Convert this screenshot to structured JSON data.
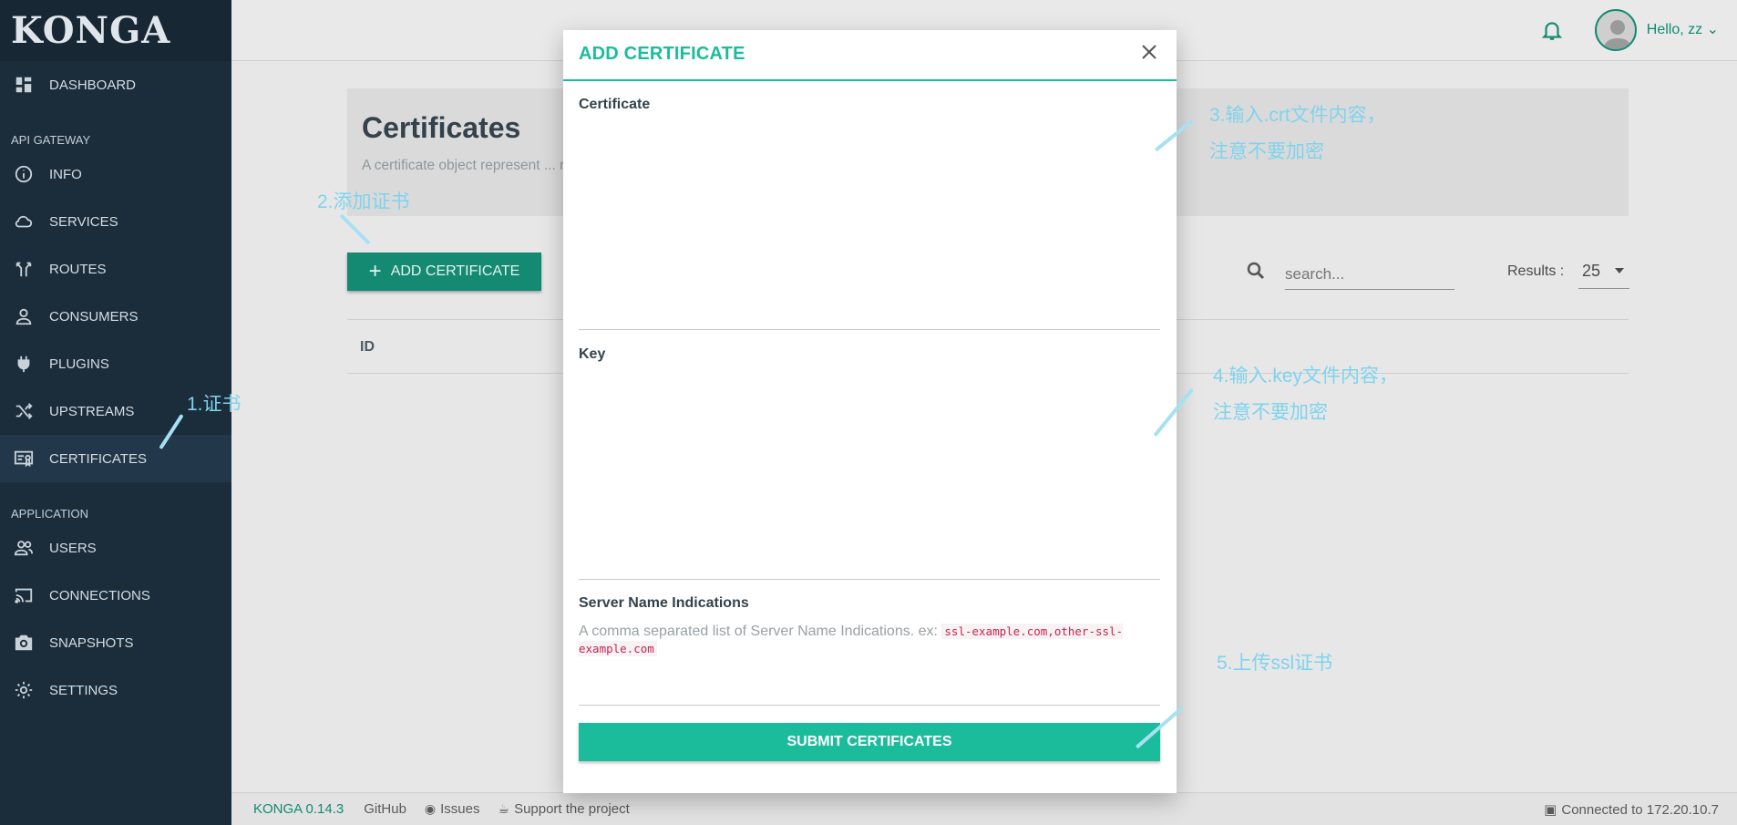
{
  "brand": "KONGA",
  "sidebar": {
    "items": [
      {
        "label": "DASHBOARD",
        "icon": "dashboard-icon"
      },
      {
        "section": "API GATEWAY"
      },
      {
        "label": "INFO",
        "icon": "info-icon"
      },
      {
        "label": "SERVICES",
        "icon": "cloud-icon"
      },
      {
        "label": "ROUTES",
        "icon": "routes-icon"
      },
      {
        "label": "CONSUMERS",
        "icon": "person-icon"
      },
      {
        "label": "PLUGINS",
        "icon": "plug-icon"
      },
      {
        "label": "UPSTREAMS",
        "icon": "shuffle-icon"
      },
      {
        "label": "CERTIFICATES",
        "icon": "certificate-icon",
        "active": true
      },
      {
        "section": "APPLICATION"
      },
      {
        "label": "USERS",
        "icon": "users-icon"
      },
      {
        "label": "CONNECTIONS",
        "icon": "cast-icon"
      },
      {
        "label": "SNAPSHOTS",
        "icon": "camera-icon"
      },
      {
        "label": "SETTINGS",
        "icon": "gear-icon"
      }
    ]
  },
  "topbar": {
    "greeting": "Hello, zz"
  },
  "page": {
    "title": "Certificates",
    "description": "A certificate object represent ... ng to handle SSL/TLS termination for encrypted requests. Certificates are optionally ass",
    "add_button": "ADD CERTIFICATE",
    "search_placeholder": "search...",
    "results_label": "Results :",
    "results_value": "25",
    "table_header_id": "ID"
  },
  "modal": {
    "title": "ADD CERTIFICATE",
    "certificate_label": "Certificate",
    "key_label": "Key",
    "sni_label": "Server Name Indications",
    "sni_hint": "A comma separated list of Server Name Indications. ex: ",
    "sni_example": "ssl-example.com,other-ssl-example.com",
    "submit": "SUBMIT CERTIFICATES"
  },
  "footer": {
    "version": "KONGA 0.14.3",
    "github": "GitHub",
    "issues": "Issues",
    "support": "Support the project",
    "connected": "Connected to 172.20.10.7"
  },
  "annotations": {
    "a1": "1.证书",
    "a2": "2.添加证书",
    "a3_line1": "3.输入.crt文件内容，",
    "a3_line2": "注意不要加密",
    "a4_line1": "4.输入.key文件内容，",
    "a4_line2": "注意不要加密",
    "a5": "5.上传ssl证书"
  },
  "colors": {
    "sidebar": "#1b2d3a",
    "accent": "#1abc9c",
    "annotation": "#7fd3ee"
  }
}
